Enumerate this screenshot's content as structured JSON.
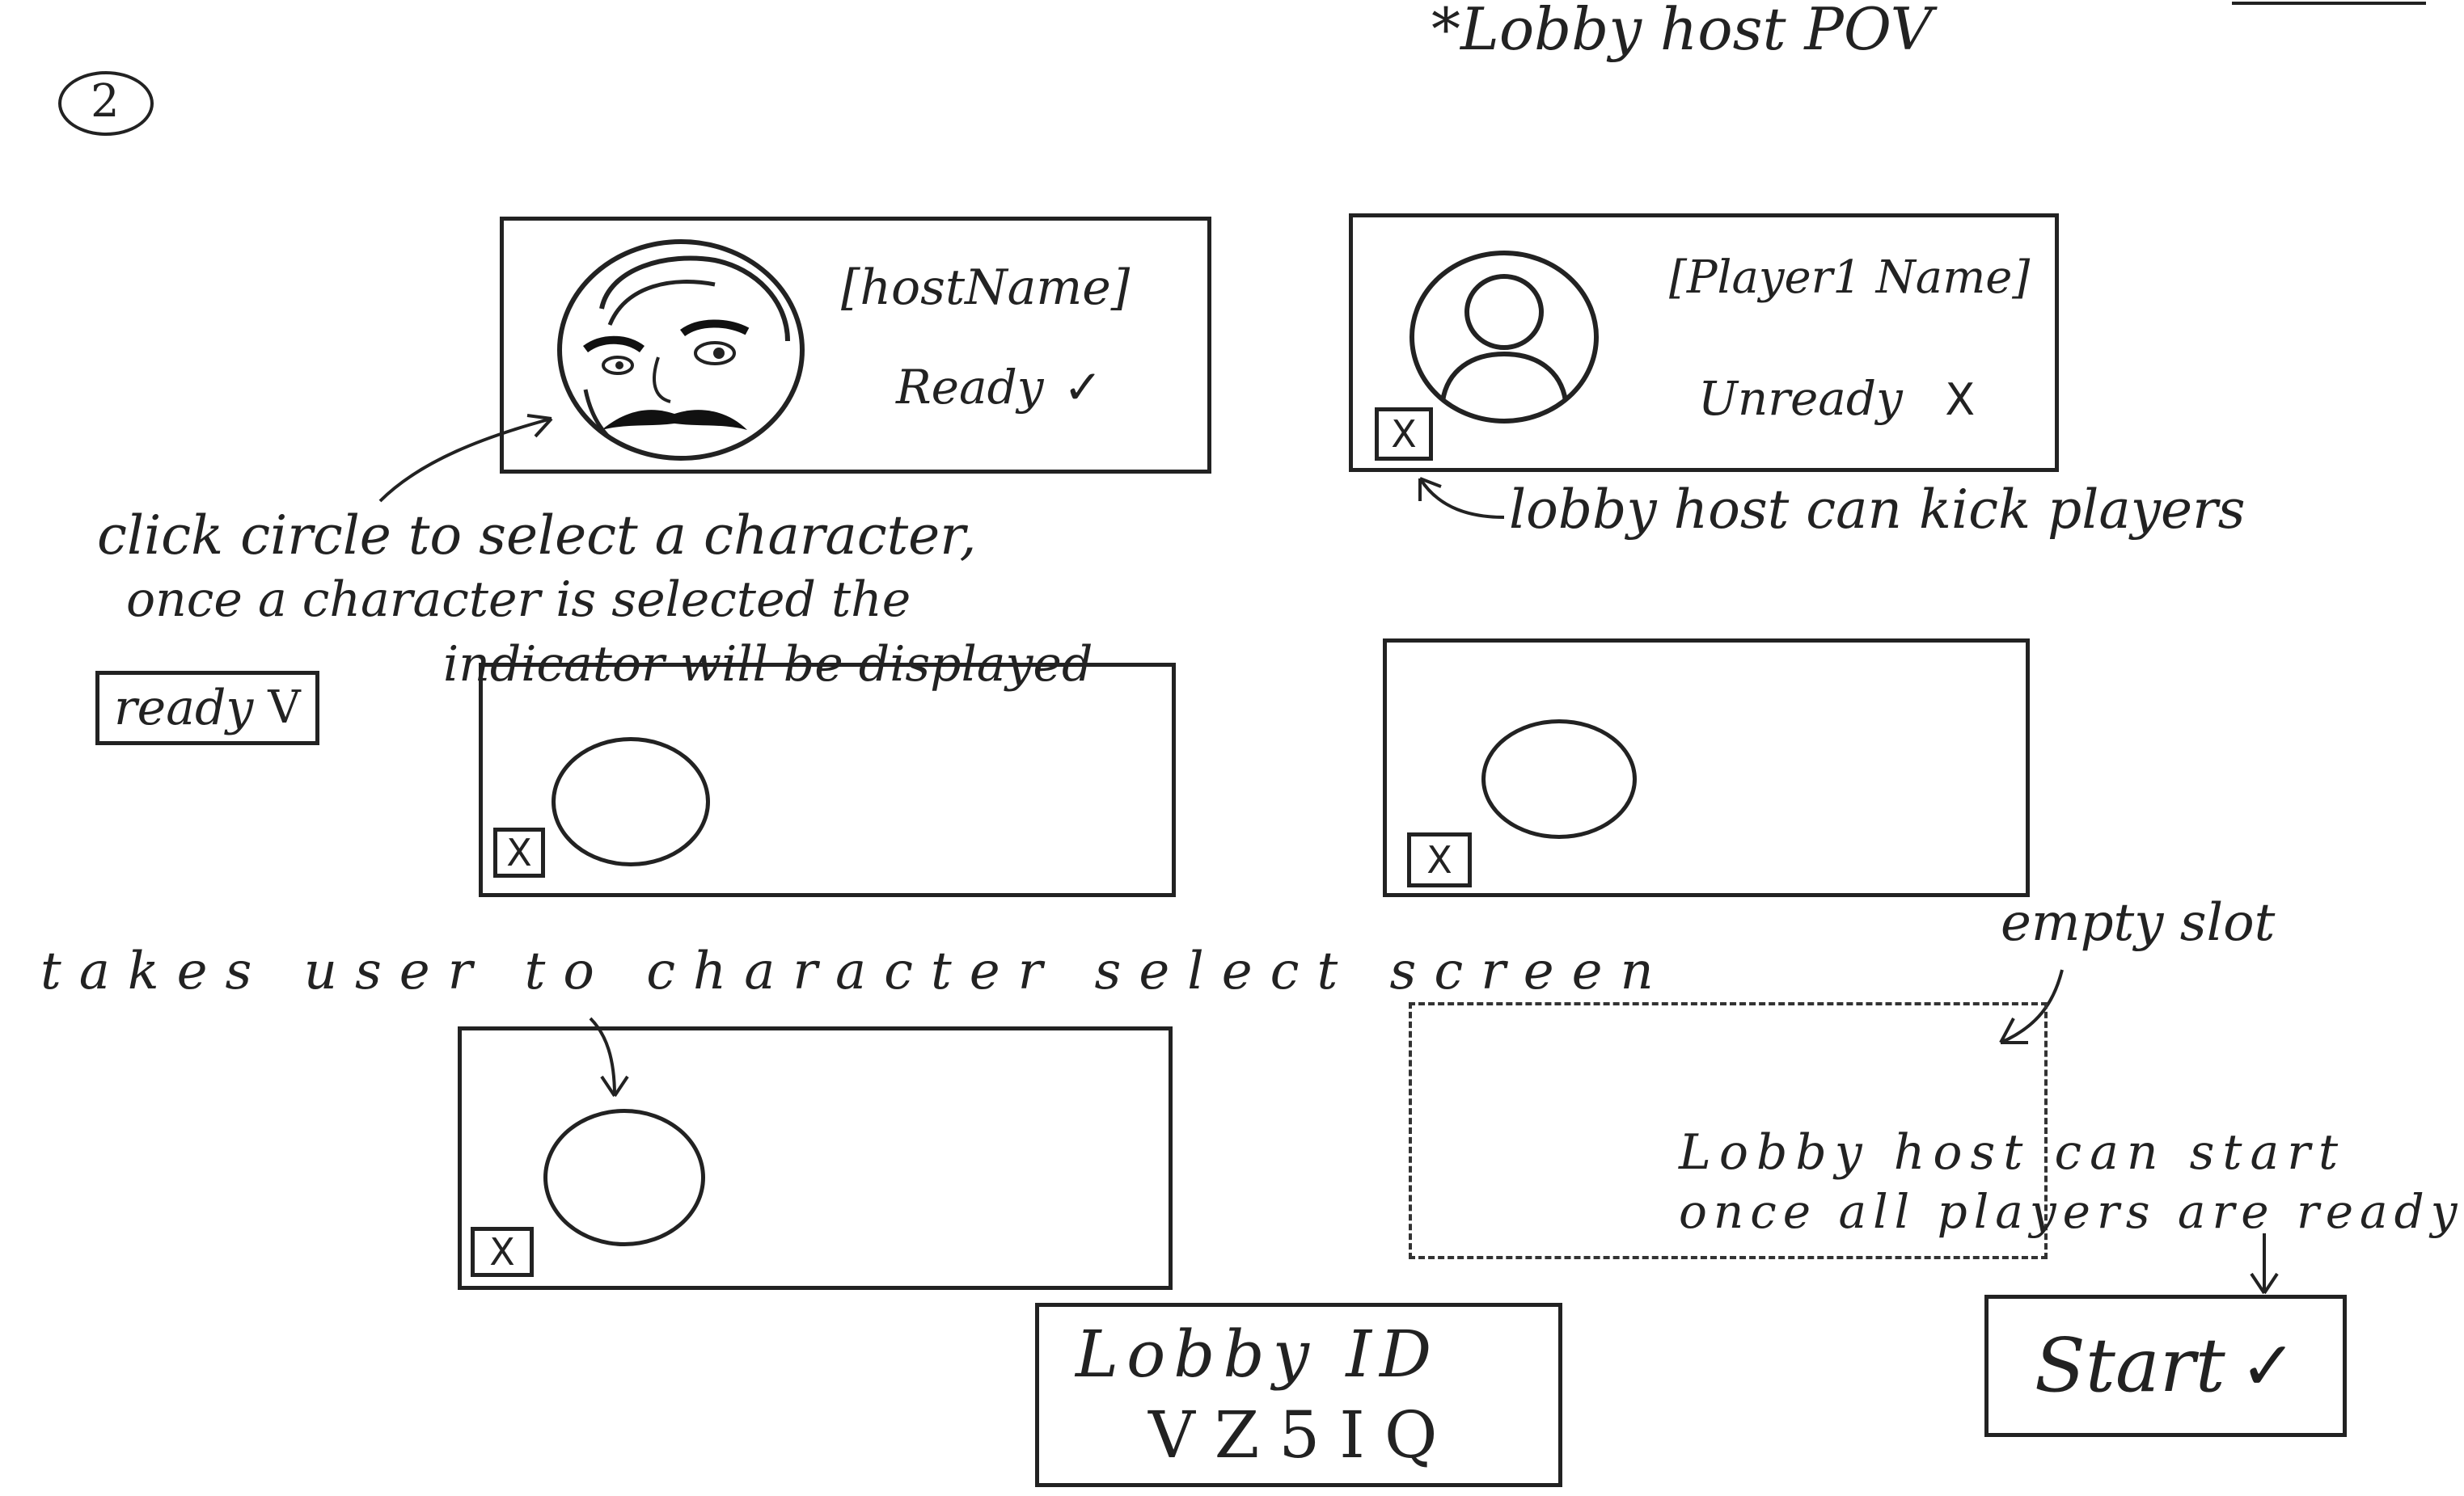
{
  "header": {
    "page_number": "2",
    "pov_note": "*Lobby host POV"
  },
  "slots": {
    "host": {
      "name": "[hostName]",
      "status": "Ready",
      "status_icon": "✓",
      "avatar": "character-portrait"
    },
    "player1": {
      "name": "[Player1 Name]",
      "status": "Unready",
      "status_icon": "X",
      "kick_label": "X",
      "avatar": "default-person-icon"
    },
    "slot3": {
      "kick_label": "X"
    },
    "slot4": {
      "kick_label": "X"
    },
    "slot5": {
      "kick_label": "X"
    }
  },
  "annotations": {
    "select_character_line1": "click circle to select a character,",
    "select_character_line2": "once a character is selected the",
    "ready_chip_label": "ready",
    "ready_chip_icon": "V",
    "select_character_line3": "indicator will be displayed",
    "kick_note": "lobby host can kick players",
    "takes_user_note": "takes user to character select screen",
    "empty_slot_note": "empty slot",
    "start_note_line1": "Lobby host can start",
    "start_note_line2": "once all players are ready"
  },
  "lobby": {
    "id_label": "Lobby ID",
    "id_value": "VZ5IQ"
  },
  "actions": {
    "start_label": "Start",
    "start_icon": "✓"
  },
  "colors": {
    "ink": "#222222",
    "paper": "#ffffff"
  }
}
